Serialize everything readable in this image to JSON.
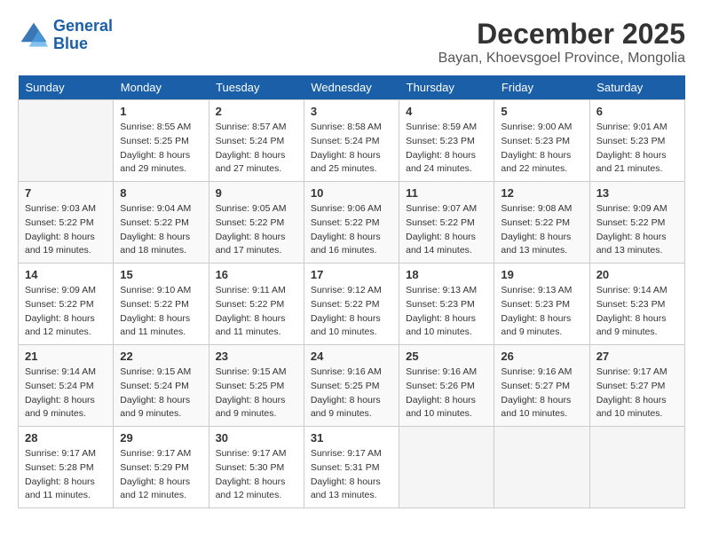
{
  "logo": {
    "line1": "General",
    "line2": "Blue"
  },
  "title": "December 2025",
  "subtitle": "Bayan, Khoevsgoel Province, Mongolia",
  "days_of_week": [
    "Sunday",
    "Monday",
    "Tuesday",
    "Wednesday",
    "Thursday",
    "Friday",
    "Saturday"
  ],
  "weeks": [
    [
      {
        "num": "",
        "info": ""
      },
      {
        "num": "1",
        "info": "Sunrise: 8:55 AM\nSunset: 5:25 PM\nDaylight: 8 hours\nand 29 minutes."
      },
      {
        "num": "2",
        "info": "Sunrise: 8:57 AM\nSunset: 5:24 PM\nDaylight: 8 hours\nand 27 minutes."
      },
      {
        "num": "3",
        "info": "Sunrise: 8:58 AM\nSunset: 5:24 PM\nDaylight: 8 hours\nand 25 minutes."
      },
      {
        "num": "4",
        "info": "Sunrise: 8:59 AM\nSunset: 5:23 PM\nDaylight: 8 hours\nand 24 minutes."
      },
      {
        "num": "5",
        "info": "Sunrise: 9:00 AM\nSunset: 5:23 PM\nDaylight: 8 hours\nand 22 minutes."
      },
      {
        "num": "6",
        "info": "Sunrise: 9:01 AM\nSunset: 5:23 PM\nDaylight: 8 hours\nand 21 minutes."
      }
    ],
    [
      {
        "num": "7",
        "info": "Sunrise: 9:03 AM\nSunset: 5:22 PM\nDaylight: 8 hours\nand 19 minutes."
      },
      {
        "num": "8",
        "info": "Sunrise: 9:04 AM\nSunset: 5:22 PM\nDaylight: 8 hours\nand 18 minutes."
      },
      {
        "num": "9",
        "info": "Sunrise: 9:05 AM\nSunset: 5:22 PM\nDaylight: 8 hours\nand 17 minutes."
      },
      {
        "num": "10",
        "info": "Sunrise: 9:06 AM\nSunset: 5:22 PM\nDaylight: 8 hours\nand 16 minutes."
      },
      {
        "num": "11",
        "info": "Sunrise: 9:07 AM\nSunset: 5:22 PM\nDaylight: 8 hours\nand 14 minutes."
      },
      {
        "num": "12",
        "info": "Sunrise: 9:08 AM\nSunset: 5:22 PM\nDaylight: 8 hours\nand 13 minutes."
      },
      {
        "num": "13",
        "info": "Sunrise: 9:09 AM\nSunset: 5:22 PM\nDaylight: 8 hours\nand 13 minutes."
      }
    ],
    [
      {
        "num": "14",
        "info": "Sunrise: 9:09 AM\nSunset: 5:22 PM\nDaylight: 8 hours\nand 12 minutes."
      },
      {
        "num": "15",
        "info": "Sunrise: 9:10 AM\nSunset: 5:22 PM\nDaylight: 8 hours\nand 11 minutes."
      },
      {
        "num": "16",
        "info": "Sunrise: 9:11 AM\nSunset: 5:22 PM\nDaylight: 8 hours\nand 11 minutes."
      },
      {
        "num": "17",
        "info": "Sunrise: 9:12 AM\nSunset: 5:22 PM\nDaylight: 8 hours\nand 10 minutes."
      },
      {
        "num": "18",
        "info": "Sunrise: 9:13 AM\nSunset: 5:23 PM\nDaylight: 8 hours\nand 10 minutes."
      },
      {
        "num": "19",
        "info": "Sunrise: 9:13 AM\nSunset: 5:23 PM\nDaylight: 8 hours\nand 9 minutes."
      },
      {
        "num": "20",
        "info": "Sunrise: 9:14 AM\nSunset: 5:23 PM\nDaylight: 8 hours\nand 9 minutes."
      }
    ],
    [
      {
        "num": "21",
        "info": "Sunrise: 9:14 AM\nSunset: 5:24 PM\nDaylight: 8 hours\nand 9 minutes."
      },
      {
        "num": "22",
        "info": "Sunrise: 9:15 AM\nSunset: 5:24 PM\nDaylight: 8 hours\nand 9 minutes."
      },
      {
        "num": "23",
        "info": "Sunrise: 9:15 AM\nSunset: 5:25 PM\nDaylight: 8 hours\nand 9 minutes."
      },
      {
        "num": "24",
        "info": "Sunrise: 9:16 AM\nSunset: 5:25 PM\nDaylight: 8 hours\nand 9 minutes."
      },
      {
        "num": "25",
        "info": "Sunrise: 9:16 AM\nSunset: 5:26 PM\nDaylight: 8 hours\nand 10 minutes."
      },
      {
        "num": "26",
        "info": "Sunrise: 9:16 AM\nSunset: 5:27 PM\nDaylight: 8 hours\nand 10 minutes."
      },
      {
        "num": "27",
        "info": "Sunrise: 9:17 AM\nSunset: 5:27 PM\nDaylight: 8 hours\nand 10 minutes."
      }
    ],
    [
      {
        "num": "28",
        "info": "Sunrise: 9:17 AM\nSunset: 5:28 PM\nDaylight: 8 hours\nand 11 minutes."
      },
      {
        "num": "29",
        "info": "Sunrise: 9:17 AM\nSunset: 5:29 PM\nDaylight: 8 hours\nand 12 minutes."
      },
      {
        "num": "30",
        "info": "Sunrise: 9:17 AM\nSunset: 5:30 PM\nDaylight: 8 hours\nand 12 minutes."
      },
      {
        "num": "31",
        "info": "Sunrise: 9:17 AM\nSunset: 5:31 PM\nDaylight: 8 hours\nand 13 minutes."
      },
      {
        "num": "",
        "info": ""
      },
      {
        "num": "",
        "info": ""
      },
      {
        "num": "",
        "info": ""
      }
    ]
  ]
}
